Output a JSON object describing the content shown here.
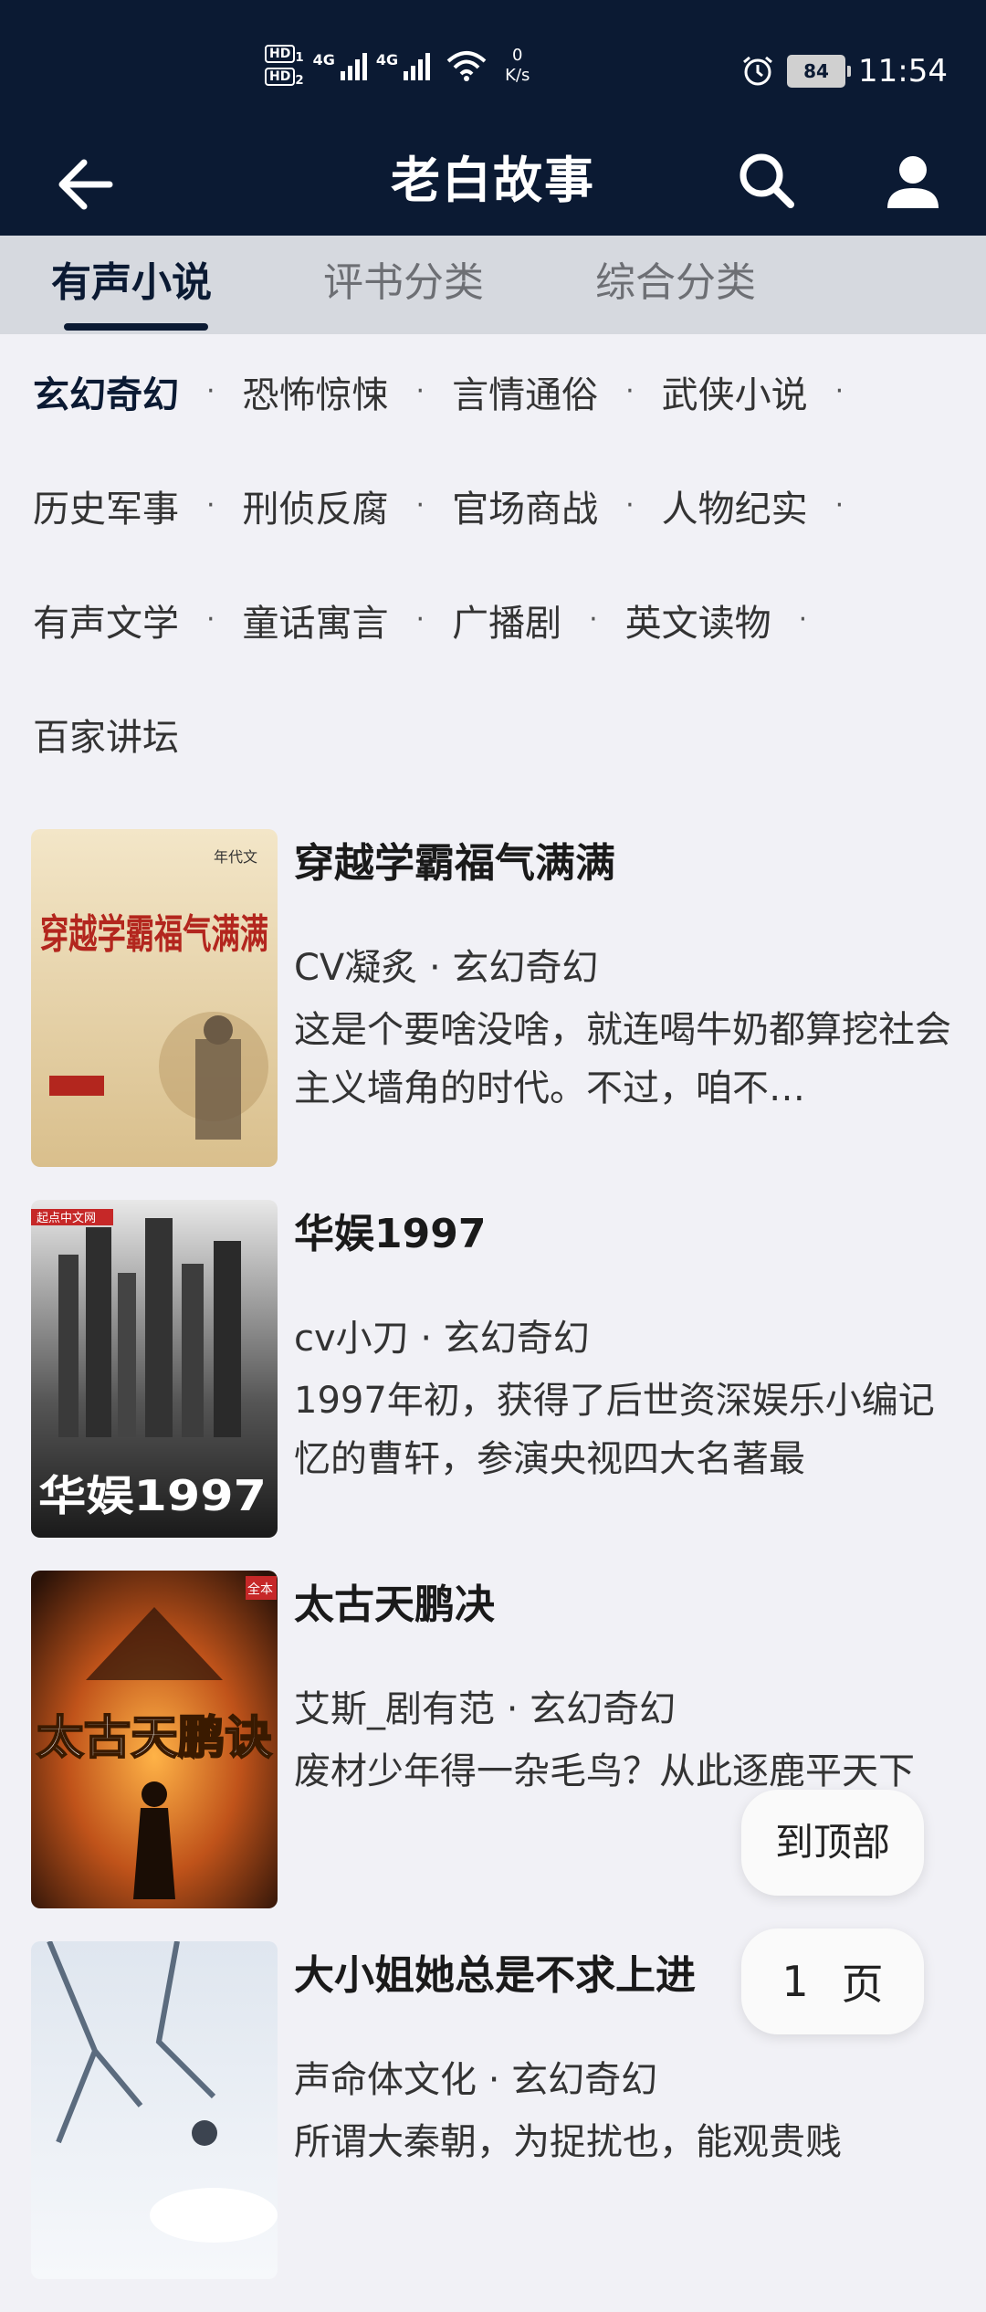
{
  "status_bar": {
    "sim1": "HD",
    "sim1_num": "1",
    "sim2": "HD",
    "sim2_num": "2",
    "net1": "4G",
    "net2": "4G",
    "speed_value": "0",
    "speed_unit": "K/s",
    "battery": "84",
    "time": "11:54"
  },
  "app_bar": {
    "title": "老白故事",
    "icons": [
      "back-arrow-icon",
      "search-icon",
      "user-icon"
    ]
  },
  "tabs": [
    {
      "label": "有声小说",
      "active": true
    },
    {
      "label": "评书分类",
      "active": false
    },
    {
      "label": "综合分类",
      "active": false
    }
  ],
  "categories": {
    "row1": [
      "玄幻奇幻",
      "恐怖惊悚",
      "言情通俗",
      "武侠小说"
    ],
    "row2": [
      "历史军事",
      "刑侦反腐",
      "官场商战",
      "人物纪实"
    ],
    "row3": [
      "有声文学",
      "童话寓言",
      "广播剧",
      "英文读物"
    ],
    "row4": [
      "百家讲坛"
    ],
    "separator": "·",
    "active": "玄幻奇幻"
  },
  "books": [
    {
      "title": "穿越学霸福气满满",
      "meta": "CV凝炙 · 玄幻奇幻",
      "desc": "这是个要啥没啥，就连喝牛奶都算挖社会主义墙角的时代。不过，咱不…",
      "cover_text": "穿越学霸福气满满",
      "cover_tag": "年代文"
    },
    {
      "title": "华娱1997",
      "meta": "cv小刀 · 玄幻奇幻",
      "desc": "1997年初，获得了后世资深娱乐小编记忆的曹轩，参演央视四大名著最",
      "cover_text": "华娱1997",
      "cover_tag": "起点中文网"
    },
    {
      "title": "太古天鹏决",
      "meta": "艾斯_剧有范 · 玄幻奇幻",
      "desc": "废材少年得一杂毛鸟？从此逐鹿平天下",
      "cover_text": "太古天鹏诀",
      "cover_tag": "全本"
    },
    {
      "title": "大小姐她总是不求上进",
      "meta": "声命体文化 · 玄幻奇幻",
      "desc": "所谓大秦朝，为捉扰也，能观贵贱",
      "cover_text": "",
      "cover_tag": ""
    }
  ],
  "fab": {
    "to_top": "到顶部",
    "page_number": "1",
    "page_unit": "页"
  }
}
